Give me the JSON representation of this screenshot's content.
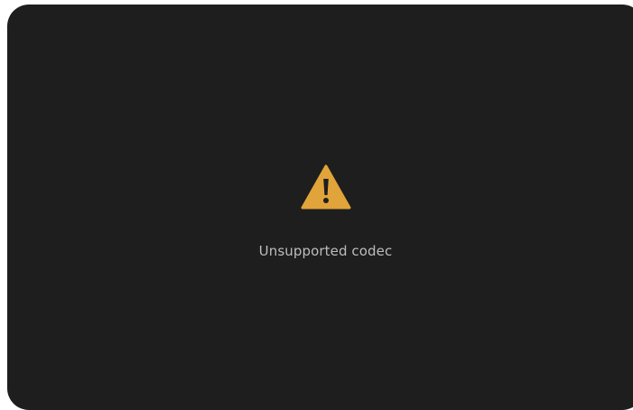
{
  "player": {
    "error": {
      "icon": "warning-icon",
      "icon_color": "#e0a43a",
      "message": "Unsupported codec"
    }
  }
}
